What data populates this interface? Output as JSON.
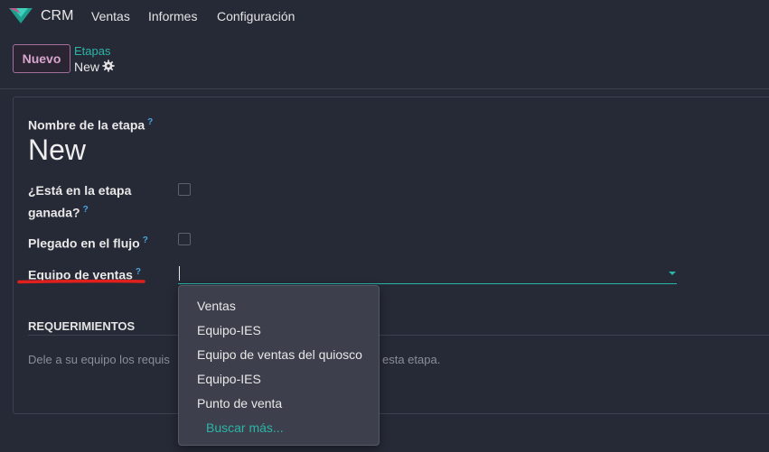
{
  "navbar": {
    "app_name": "CRM",
    "menu": [
      "Ventas",
      "Informes",
      "Configuración"
    ]
  },
  "control_panel": {
    "new_button": "Nuevo",
    "breadcrumb_parent": "Etapas",
    "breadcrumb_current": "New"
  },
  "form": {
    "stage_name_label": "Nombre de la etapa",
    "stage_name_value": "New",
    "won_stage_label_line1": "¿Está en la etapa",
    "won_stage_label_line2": "ganada?",
    "won_stage_checked": false,
    "folded_label": "Plegado en el flujo",
    "folded_checked": false,
    "sales_team_label": "Equipo de ventas",
    "sales_team_value": "",
    "help_mark": "?"
  },
  "requirements": {
    "title": "REQUERIMIENTOS",
    "placeholder_start": "Dele a su equipo los requis",
    "placeholder_end": "esta etapa."
  },
  "dropdown": {
    "options": [
      "Ventas",
      "Equipo-IES",
      "Equipo de ventas del quiosco",
      "Equipo-IES",
      "Punto de venta"
    ],
    "search_more": "Buscar más..."
  },
  "colors": {
    "accent": "#2bb5a8",
    "primary_button": "#a2709a",
    "help": "#4aa3e0",
    "annotation": "#e0201c"
  }
}
